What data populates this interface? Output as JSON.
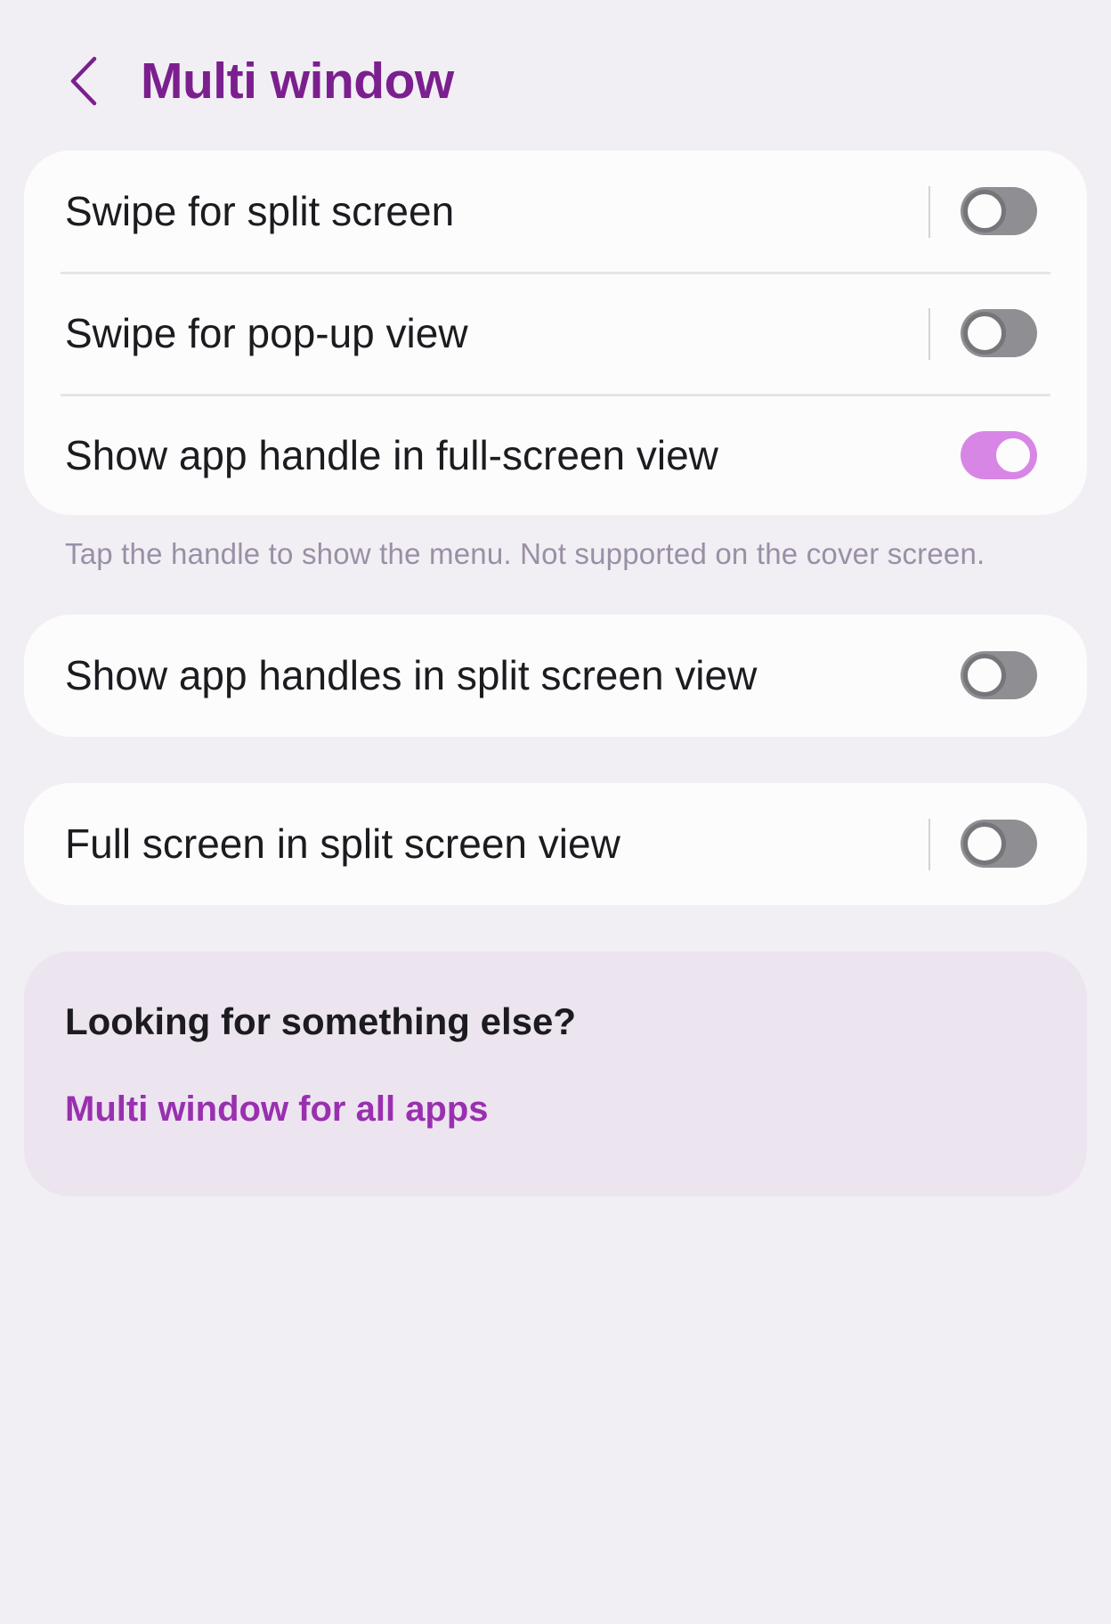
{
  "header": {
    "title": "Multi window",
    "back_icon": "chevron-left-icon"
  },
  "colors": {
    "accent": "#7b1f8f",
    "link": "#9a2fb0",
    "switch_on": "#d786e6",
    "switch_off": "#8f8e93",
    "background": "#f1eff4"
  },
  "settings_group_1": {
    "items": [
      {
        "label": "Swipe for split screen",
        "enabled": false
      },
      {
        "label": "Swipe for pop-up view",
        "enabled": false
      },
      {
        "label": "Show app handle in full-screen view",
        "enabled": true
      }
    ],
    "hint": "Tap the handle to show the menu. Not supported on the cover screen."
  },
  "settings_group_2": {
    "label": "Show app handles in split screen view",
    "enabled": false
  },
  "settings_group_3": {
    "label": "Full screen in split screen view",
    "enabled": false
  },
  "suggestions": {
    "title": "Looking for something else?",
    "link": "Multi window for all apps"
  }
}
